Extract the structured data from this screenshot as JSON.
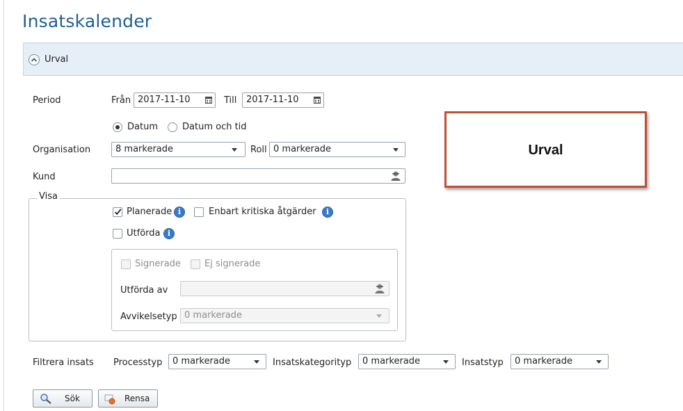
{
  "page": {
    "title": "Insatskalender"
  },
  "section": {
    "label": "Urval"
  },
  "period": {
    "label": "Period",
    "from_label": "Från",
    "from_value": "2017-11-10",
    "to_label": "Till",
    "to_value": "2017-11-10",
    "mode_options": [
      {
        "label": "Datum",
        "selected": true
      },
      {
        "label": "Datum och tid",
        "selected": false
      }
    ]
  },
  "organisation": {
    "label": "Organisation",
    "value": "8 markerade"
  },
  "roll": {
    "label": "Roll",
    "value": "0 markerade"
  },
  "kund": {
    "label": "Kund",
    "value": ""
  },
  "visa": {
    "legend": "Visa",
    "planerade": {
      "label": "Planerade",
      "checked": true
    },
    "kritiska": {
      "label": "Enbart kritiska åtgärder",
      "checked": false
    },
    "utforda": {
      "label": "Utförda",
      "checked": false
    },
    "signerade": {
      "label": "Signerade",
      "checked": false
    },
    "ej_signerade": {
      "label": "Ej signerade",
      "checked": false
    },
    "utforda_av": {
      "label": "Utförda av",
      "value": ""
    },
    "avvikelsetyp": {
      "label": "Avvikelsetyp",
      "value": "0 markerade"
    }
  },
  "filter": {
    "label": "Filtrera insats",
    "processtyp": {
      "label": "Processtyp",
      "value": "0 markerade"
    },
    "insatskategorityp": {
      "label": "Insatskategorityp",
      "value": "0 markerade"
    },
    "insatstyp": {
      "label": "Insatstyp",
      "value": "0 markerade"
    }
  },
  "buttons": {
    "search": "Sök",
    "clear": "Rensa"
  },
  "callout": {
    "text": "Urval"
  },
  "colors": {
    "title": "#1f5f95",
    "header_bg": "#e6eef8",
    "callout_border": "#c24e34",
    "info": "#3a7bc8"
  }
}
